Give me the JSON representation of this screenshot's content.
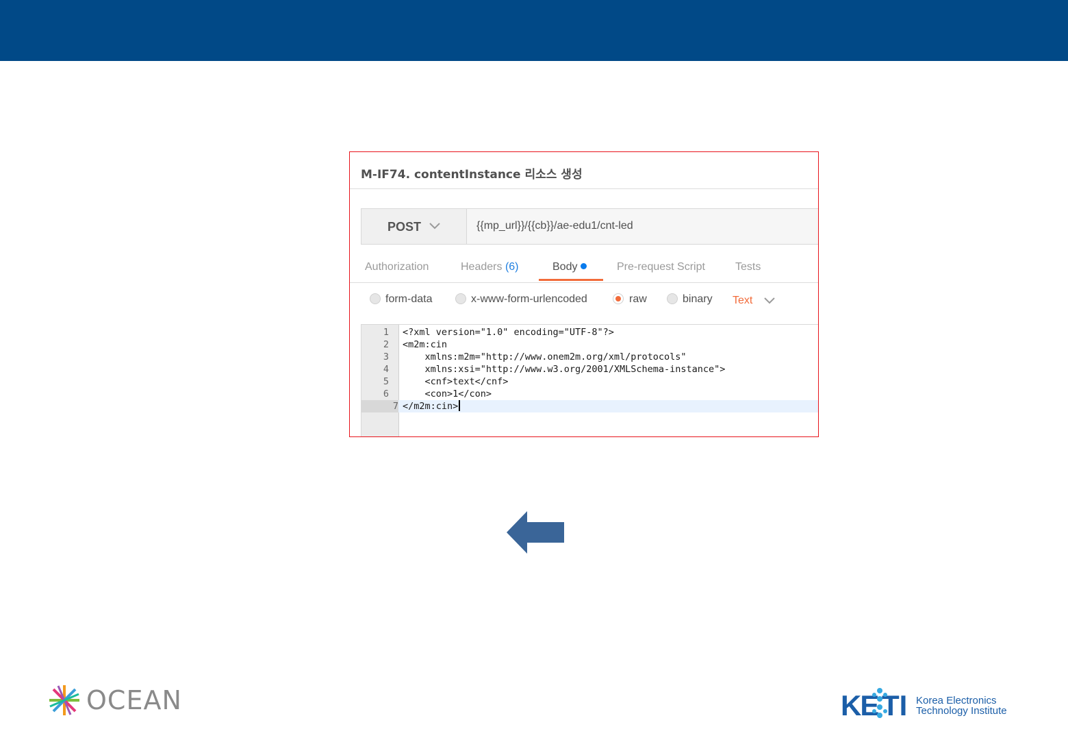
{
  "slide": {
    "colors": {
      "header_bar": "#014987",
      "highlight_border": "#e8141b",
      "arrow": "#3a6598"
    }
  },
  "request": {
    "title": "M-IF74. contentInstance 리소스 생성",
    "method": "POST",
    "url": "{{mp_url}}/{{cb}}/ae-edu1/cnt-led",
    "tabs": {
      "authorization": "Authorization",
      "headers": "Headers",
      "headers_count": "(6)",
      "body": "Body",
      "prerequest": "Pre-request Script",
      "tests": "Tests",
      "active": "Body"
    },
    "body_modes": {
      "form_data": "form-data",
      "urlencoded": "x-www-form-urlencoded",
      "raw": "raw",
      "binary": "binary",
      "selected": "raw",
      "content_type": "Text"
    },
    "editor": {
      "lines": [
        {
          "num": "1",
          "code": "<?xml version=\"1.0\" encoding=\"UTF-8\"?>"
        },
        {
          "num": "2",
          "code": "<m2m:cin"
        },
        {
          "num": "3",
          "code": "    xmlns:m2m=\"http://www.onem2m.org/xml/protocols\""
        },
        {
          "num": "4",
          "code": "    xmlns:xsi=\"http://www.w3.org/2001/XMLSchema-instance\">"
        },
        {
          "num": "5",
          "code": "    <cnf>text</cnf>"
        },
        {
          "num": "6",
          "code": "    <con>1</con>"
        },
        {
          "num": "7",
          "code": "</m2m:cin>"
        }
      ],
      "active_line": "7"
    }
  },
  "footer": {
    "ocean_logo_text": "OCEAN",
    "keti_logo_text": "KETI",
    "keti_name_line1": "Korea Electronics",
    "keti_name_line2": "Technology Institute"
  }
}
